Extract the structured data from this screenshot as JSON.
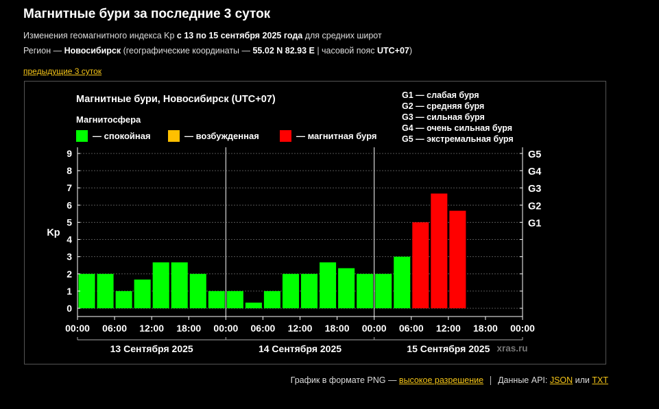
{
  "header": {
    "title": "Магнитные бури за последние 3 суток",
    "sub1_pre": "Изменения геомагнитного индекса Kp ",
    "sub1_bold": "с 13 по 15 сентября 2025 года",
    "sub1_post": " для средних широт",
    "sub2_pre": "Регион — ",
    "sub2_city": "Новосибирск",
    "sub2_mid": " (географические координаты — ",
    "sub2_coords": "55.02 N 82.93 E",
    "sub2_mid2": " | часовой пояс ",
    "sub2_tz": "UTC+07",
    "sub2_post": ")"
  },
  "prev_link": "предыдущие 3 суток",
  "footer": {
    "png_text": "График в формате PNG — ",
    "hires_link": "высокое разрешение",
    "api_text": "Данные API: ",
    "json_link": "JSON",
    "or_text": " или ",
    "txt_link": "TXT"
  },
  "chart_data": {
    "type": "bar",
    "title": "Магнитные бури, Новосибирск (UTC+07)",
    "legend_title": "Магнитосфера",
    "legend": [
      {
        "label": "— спокойная",
        "color": "#00ff00"
      },
      {
        "label": "— возбужденная",
        "color": "#ffc000"
      },
      {
        "label": "— магнитная буря",
        "color": "#ff0000"
      }
    ],
    "g_scale": [
      "G1 — слабая буря",
      "G2 — средняя буря",
      "G3 — сильная буря",
      "G4 — очень сильная буря",
      "G5 — экстремальная буря"
    ],
    "ylabel": "Kp",
    "ylim": [
      0,
      9
    ],
    "y_ticks": [
      "0",
      "1",
      "2",
      "3",
      "4",
      "5",
      "6",
      "7",
      "8",
      "9"
    ],
    "right_ticks": [
      {
        "value": 5,
        "label": "G1"
      },
      {
        "value": 6,
        "label": "G2"
      },
      {
        "value": 7,
        "label": "G3"
      },
      {
        "value": 8,
        "label": "G4"
      },
      {
        "value": 9,
        "label": "G5"
      }
    ],
    "x_ticks": [
      "00:00",
      "06:00",
      "12:00",
      "18:00",
      "00:00",
      "06:00",
      "12:00",
      "18:00",
      "00:00",
      "06:00",
      "12:00",
      "18:00",
      "00:00"
    ],
    "days": [
      "13 Сентября 2025",
      "14 Сентября 2025",
      "15 Сентября 2025"
    ],
    "watermark": "xras.ru",
    "interval_hours": 3,
    "values": [
      2.0,
      2.0,
      1.0,
      1.67,
      2.67,
      2.67,
      2.0,
      1.0,
      1.0,
      0.33,
      1.0,
      2.0,
      2.0,
      2.67,
      2.33,
      2.0,
      2.0,
      3.0,
      5.0,
      6.67,
      5.67
    ],
    "colors": [
      "#00ff00",
      "#00ff00",
      "#00ff00",
      "#00ff00",
      "#00ff00",
      "#00ff00",
      "#00ff00",
      "#00ff00",
      "#00ff00",
      "#00ff00",
      "#00ff00",
      "#00ff00",
      "#00ff00",
      "#00ff00",
      "#00ff00",
      "#00ff00",
      "#00ff00",
      "#00ff00",
      "#ff0000",
      "#ff0000",
      "#ff0000"
    ]
  }
}
